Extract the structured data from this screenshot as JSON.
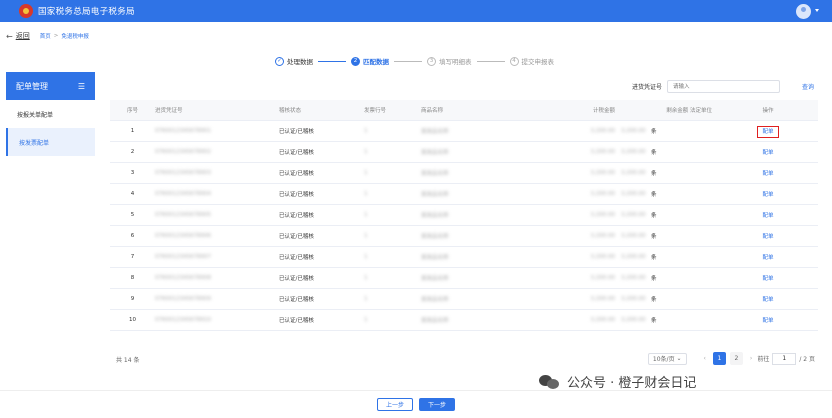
{
  "header": {
    "title": "国家税务总局电子税务局"
  },
  "breadcrumb": {
    "back": "返回",
    "items": [
      "首页",
      "免退税申报"
    ],
    "sep": ">"
  },
  "steps": [
    {
      "num": "✓",
      "label": "处理数据",
      "state": "done"
    },
    {
      "num": "2",
      "label": "匹配数据",
      "state": "active"
    },
    {
      "num": "3",
      "label": "填写明细表",
      "state": "future"
    },
    {
      "num": "4",
      "label": "提交申报表",
      "state": "future"
    }
  ],
  "sidebar": {
    "title": "配单管理",
    "items": [
      {
        "label": "按报关单配单"
      },
      {
        "label": "按发票配单"
      }
    ]
  },
  "search": {
    "label": "进货凭证号",
    "placeholder": "请输入",
    "button": "查询"
  },
  "table": {
    "headers": [
      "序号",
      "进货凭证号",
      "稽核状态",
      "发票行号",
      "商品名称",
      "计税金额",
      "剩余金额",
      "法定单位",
      "操作"
    ],
    "rows": [
      {
        "no": "1",
        "voucher": "0760012345678901",
        "status": "已认证/已稽核",
        "line": "1",
        "goods": "某商品名称",
        "amount": "3,200.00",
        "remain": "3,200.00",
        "unit": "条",
        "op": "配单"
      },
      {
        "no": "2",
        "voucher": "0760012345678902",
        "status": "已认证/已稽核",
        "line": "1",
        "goods": "某商品名称",
        "amount": "3,200.00",
        "remain": "3,200.00",
        "unit": "条",
        "op": "配单"
      },
      {
        "no": "3",
        "voucher": "0760012345678903",
        "status": "已认证/已稽核",
        "line": "1",
        "goods": "某商品名称",
        "amount": "3,200.00",
        "remain": "3,200.00",
        "unit": "条",
        "op": "配单"
      },
      {
        "no": "4",
        "voucher": "0760012345678904",
        "status": "已认证/已稽核",
        "line": "1",
        "goods": "某商品名称",
        "amount": "3,200.00",
        "remain": "3,200.00",
        "unit": "条",
        "op": "配单"
      },
      {
        "no": "5",
        "voucher": "0760012345678905",
        "status": "已认证/已稽核",
        "line": "1",
        "goods": "某商品名称",
        "amount": "3,200.00",
        "remain": "3,200.00",
        "unit": "条",
        "op": "配单"
      },
      {
        "no": "6",
        "voucher": "0760012345678906",
        "status": "已认证/已稽核",
        "line": "1",
        "goods": "某商品名称",
        "amount": "3,200.00",
        "remain": "3,200.00",
        "unit": "条",
        "op": "配单"
      },
      {
        "no": "7",
        "voucher": "0760012345678907",
        "status": "已认证/已稽核",
        "line": "1",
        "goods": "某商品名称",
        "amount": "3,200.00",
        "remain": "3,200.00",
        "unit": "条",
        "op": "配单"
      },
      {
        "no": "8",
        "voucher": "0760012345678908",
        "status": "已认证/已稽核",
        "line": "1",
        "goods": "某商品名称",
        "amount": "3,200.00",
        "remain": "3,200.00",
        "unit": "条",
        "op": "配单"
      },
      {
        "no": "9",
        "voucher": "0760012345678909",
        "status": "已认证/已稽核",
        "line": "1",
        "goods": "某商品名称",
        "amount": "3,200.00",
        "remain": "3,200.00",
        "unit": "条",
        "op": "配单"
      },
      {
        "no": "10",
        "voucher": "0760012345678910",
        "status": "已认证/已稽核",
        "line": "1",
        "goods": "某商品名称",
        "amount": "3,200.00",
        "remain": "3,200.00",
        "unit": "条",
        "op": "配单"
      }
    ]
  },
  "footer": {
    "total": "共 14 条",
    "pagesize": "10条/页",
    "pages": [
      "1",
      "2"
    ],
    "current_page": "1",
    "goto_label": "前往",
    "goto_value": "1",
    "goto_suffix": "/ 2 页"
  },
  "actions": {
    "prev": "上一步",
    "next": "下一步"
  },
  "watermark": {
    "text": "公众号 · 橙子财会日记"
  }
}
